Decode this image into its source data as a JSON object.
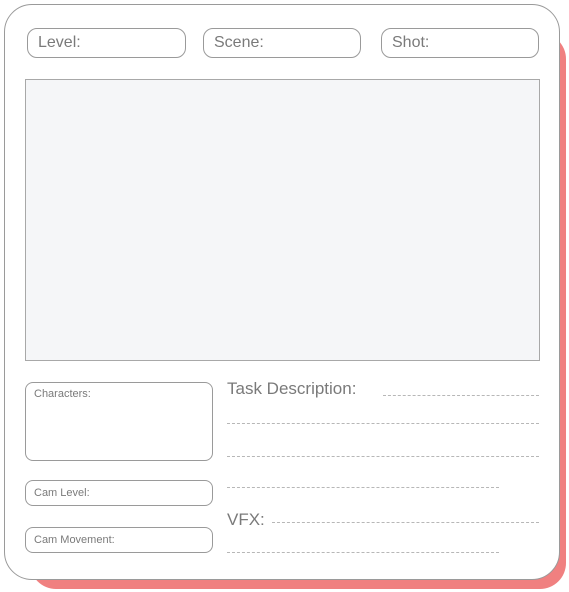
{
  "header": {
    "level_label": "Level:",
    "scene_label": "Scene:",
    "shot_label": "Shot:"
  },
  "left_panel": {
    "characters_label": "Characters:",
    "cam_level_label": "Cam Level:",
    "cam_movement_label": "Cam Movement:"
  },
  "right_panel": {
    "task_description_label": "Task Description:",
    "vfx_label": "VFX:"
  },
  "colors": {
    "accent_shadow": "#f08080",
    "border": "#9a9a9a",
    "text": "#7a7a7a",
    "frame_fill": "#f5f6f8"
  }
}
